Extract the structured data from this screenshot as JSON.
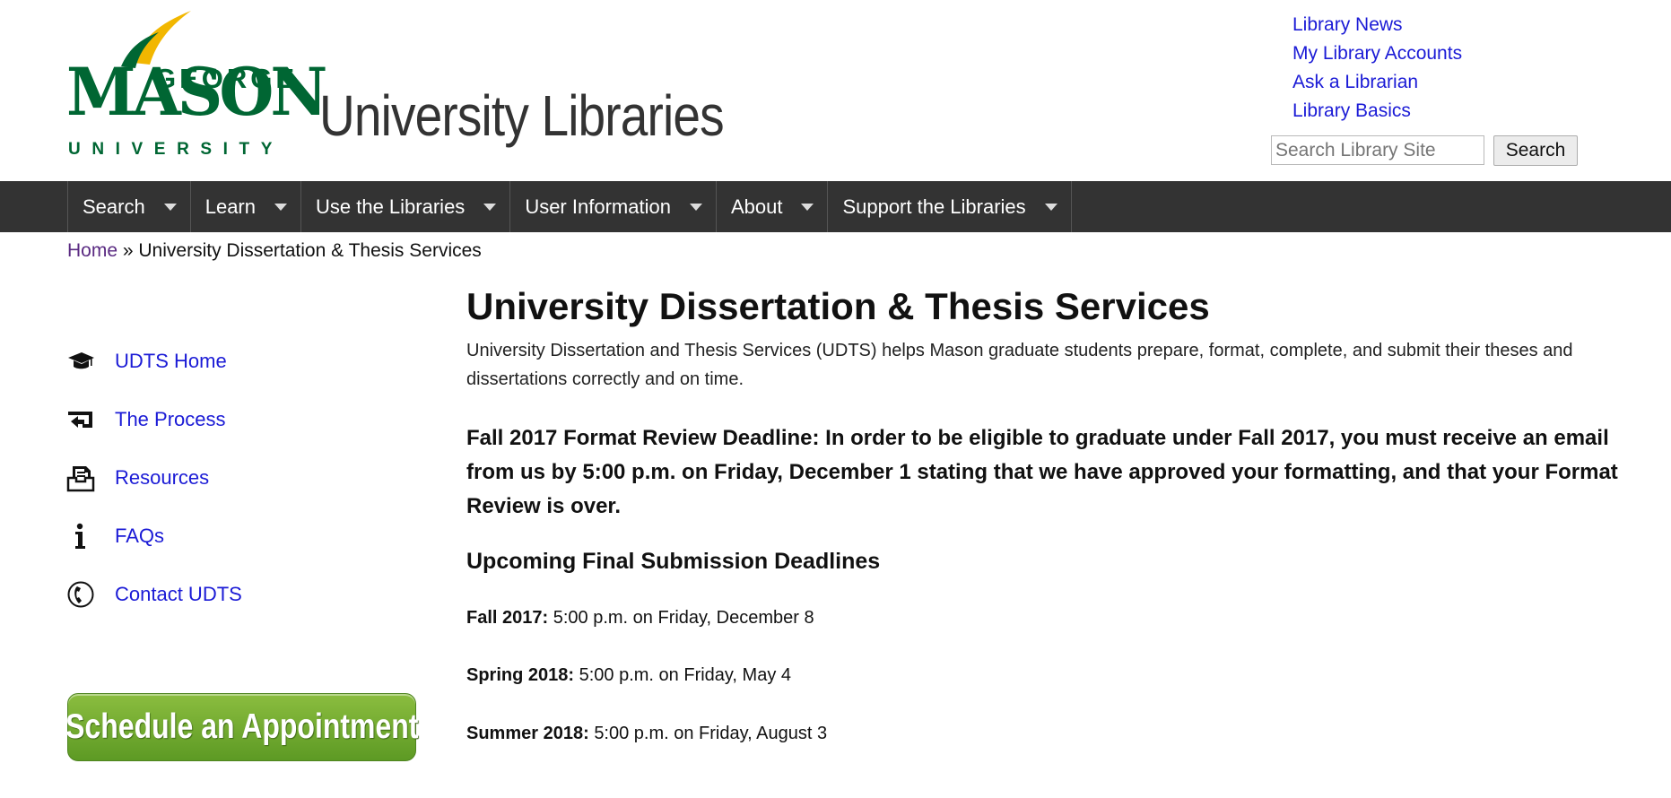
{
  "header": {
    "logo": {
      "line1": "GEORGE",
      "line2": "MASON",
      "line3": "UNIVERSITY"
    },
    "site_title": "University Libraries",
    "utility_links": [
      "Library News",
      "My Library Accounts",
      "Ask a Librarian",
      "Library Basics"
    ],
    "search": {
      "placeholder": "Search Library Site",
      "value": "",
      "button_label": "Search"
    }
  },
  "nav": {
    "items": [
      {
        "label": "Search"
      },
      {
        "label": "Learn"
      },
      {
        "label": "Use the Libraries"
      },
      {
        "label": "User Information"
      },
      {
        "label": "About"
      },
      {
        "label": "Support the Libraries"
      }
    ]
  },
  "breadcrumb": {
    "home": "Home",
    "separator": " » ",
    "current": "University Dissertation & Thesis Services"
  },
  "sidebar": {
    "items": [
      {
        "label": "UDTS Home",
        "icon": "graduation-cap-icon"
      },
      {
        "label": "The Process",
        "icon": "return-arrow-icon"
      },
      {
        "label": "Resources",
        "icon": "document-tray-icon"
      },
      {
        "label": "FAQs",
        "icon": "info-icon"
      },
      {
        "label": "Contact UDTS",
        "icon": "phone-icon"
      }
    ],
    "appointment_button": "Schedule an Appointment"
  },
  "main": {
    "title": "University Dissertation & Thesis Services",
    "intro": "University Dissertation and Thesis Services (UDTS) helps Mason graduate students prepare, format, complete, and submit their theses and dissertations correctly and on time.",
    "notice": "Fall 2017 Format Review Deadline: In order to be eligible to graduate under Fall 2017, you must receive an email from us by 5:00 p.m. on Friday, December 1 stating that we have approved your formatting, and that your Format Review is over.",
    "deadlines_heading": "Upcoming Final Submission Deadlines",
    "deadlines": [
      {
        "term": "Fall 2017:",
        "when": "5:00 p.m. on Friday, December 8"
      },
      {
        "term": "Spring 2018:",
        "when": "5:00 p.m. on Friday, May 4"
      },
      {
        "term": "Summer 2018:",
        "when": "5:00 p.m. on Friday, August 3"
      }
    ]
  },
  "colors": {
    "brand_green": "#006633",
    "brand_gold": "#f2b700",
    "nav_bg": "#333333",
    "link": "#1b1bd6",
    "button_green": "#6fa52e"
  }
}
